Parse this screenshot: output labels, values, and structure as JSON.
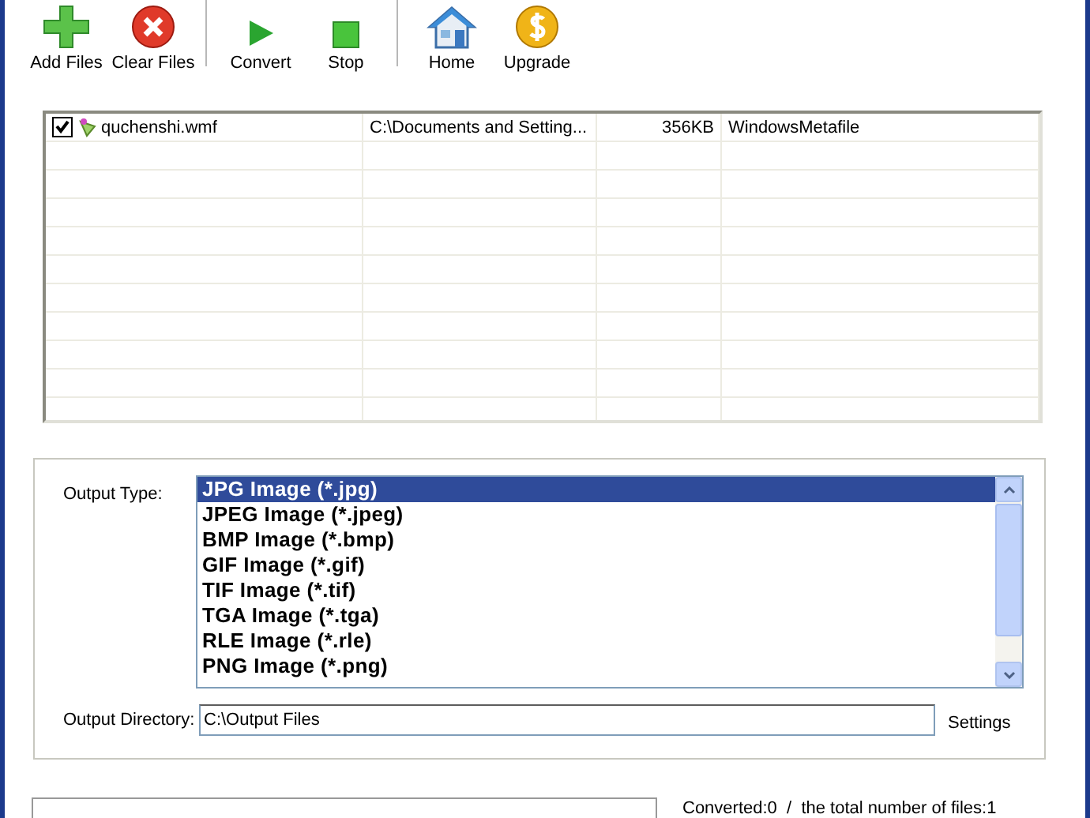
{
  "toolbar": [
    {
      "kind": "add",
      "label": "Add Files"
    },
    {
      "kind": "clear",
      "label": "Clear Files"
    },
    {
      "kind": "convert",
      "label": "Convert"
    },
    {
      "kind": "stop",
      "label": "Stop"
    },
    {
      "kind": "home",
      "label": "Home"
    },
    {
      "kind": "upgrade",
      "label": "Upgrade"
    }
  ],
  "files": [
    {
      "checked": true,
      "name": "quchenshi.wmf",
      "path": "C:\\Documents and Setting...",
      "size": "356KB",
      "type": "WindowsMetafile"
    }
  ],
  "output": {
    "type_label": "Output Type:",
    "types": [
      {
        "label": "JPG Image (*.jpg)",
        "selected": true
      },
      {
        "label": "JPEG Image (*.jpeg)",
        "selected": false
      },
      {
        "label": "BMP Image (*.bmp)",
        "selected": false
      },
      {
        "label": "GIF Image (*.gif)",
        "selected": false
      },
      {
        "label": "TIF Image (*.tif)",
        "selected": false
      },
      {
        "label": "TGA Image (*.tga)",
        "selected": false
      },
      {
        "label": "RLE Image (*.rle)",
        "selected": false
      },
      {
        "label": "PNG Image (*.png)",
        "selected": false
      }
    ],
    "directory_label": "Output Directory:",
    "directory": "C:\\Output Files",
    "settings": "Settings"
  },
  "progress": {
    "level": 0
  },
  "status": {
    "converted": "Converted:0",
    "separator": "/",
    "total": "the total number of files:1"
  }
}
